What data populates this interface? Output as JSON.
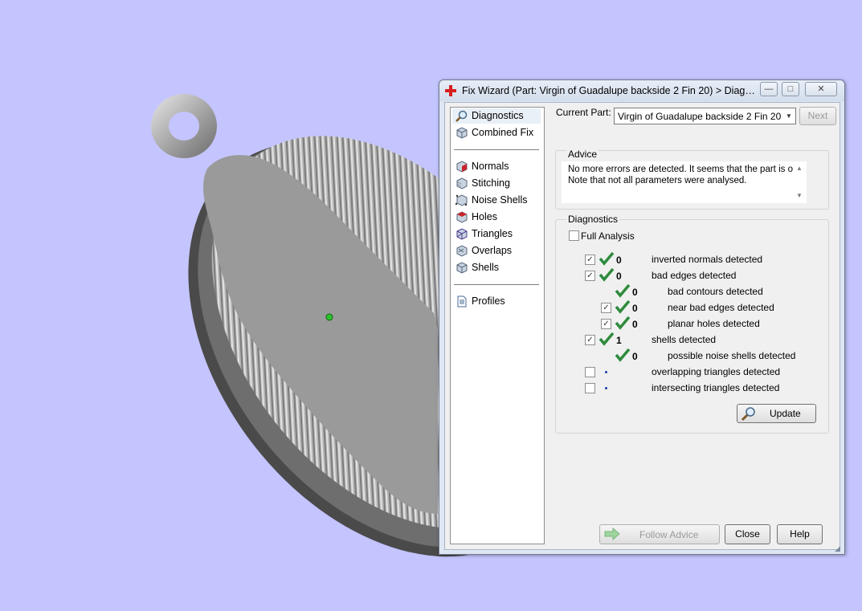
{
  "window": {
    "title": "Fix Wizard (Part: Virgin of Guadalupe backside 2 Fin 20) > Diagnost...",
    "minimize": "—",
    "maximize": "□",
    "close": "✕"
  },
  "nav": {
    "items": [
      {
        "label": "Diagnostics",
        "icon": "magnifier-icon"
      },
      {
        "label": "Combined Fix",
        "icon": "cube-icon"
      },
      {
        "label": "Normals",
        "icon": "normals-cube-icon"
      },
      {
        "label": "Stitching",
        "icon": "stitching-cube-icon"
      },
      {
        "label": "Noise Shells",
        "icon": "noise-shells-icon"
      },
      {
        "label": "Holes",
        "icon": "holes-cube-icon"
      },
      {
        "label": "Triangles",
        "icon": "triangles-cube-icon"
      },
      {
        "label": "Overlaps",
        "icon": "overlaps-cube-icon"
      },
      {
        "label": "Shells",
        "icon": "shells-cube-icon"
      },
      {
        "label": "Profiles",
        "icon": "document-icon"
      }
    ]
  },
  "part": {
    "label": "Current Part:",
    "value": "Virgin of Guadalupe backside 2 Fin 20",
    "next": "Next"
  },
  "advice": {
    "title": "Advice",
    "line1": "No more errors are detected. It seems that the part is ok.",
    "line2": "Note that not all parameters were analysed."
  },
  "diagnostics": {
    "title": "Diagnostics",
    "full_analysis": "Full Analysis",
    "rows": [
      {
        "count": "0",
        "text": "inverted normals detected",
        "checked": true,
        "ok": true
      },
      {
        "count": "0",
        "text": "bad edges detected",
        "checked": true,
        "ok": true
      },
      {
        "count": "0",
        "text": "bad contours detected",
        "checked": null,
        "ok": true
      },
      {
        "count": "0",
        "text": "near bad edges detected",
        "checked": true,
        "ok": true
      },
      {
        "count": "0",
        "text": "planar holes detected",
        "checked": true,
        "ok": true
      },
      {
        "count": "1",
        "text": "shells detected",
        "checked": true,
        "ok": true
      },
      {
        "count": "0",
        "text": "possible noise shells detected",
        "checked": null,
        "ok": true
      },
      {
        "count": "",
        "text": "overlapping triangles detected",
        "checked": false,
        "ok": false
      },
      {
        "count": "",
        "text": "intersecting triangles detected",
        "checked": false,
        "ok": false
      }
    ],
    "update": "Update"
  },
  "footer": {
    "follow_advice": "Follow Advice",
    "close": "Close",
    "help": "Help"
  },
  "colors": {
    "viewport_bg": "#c4c4fe",
    "check_green": "#2e8b3c",
    "title_icon_red": "#d81e1e"
  }
}
